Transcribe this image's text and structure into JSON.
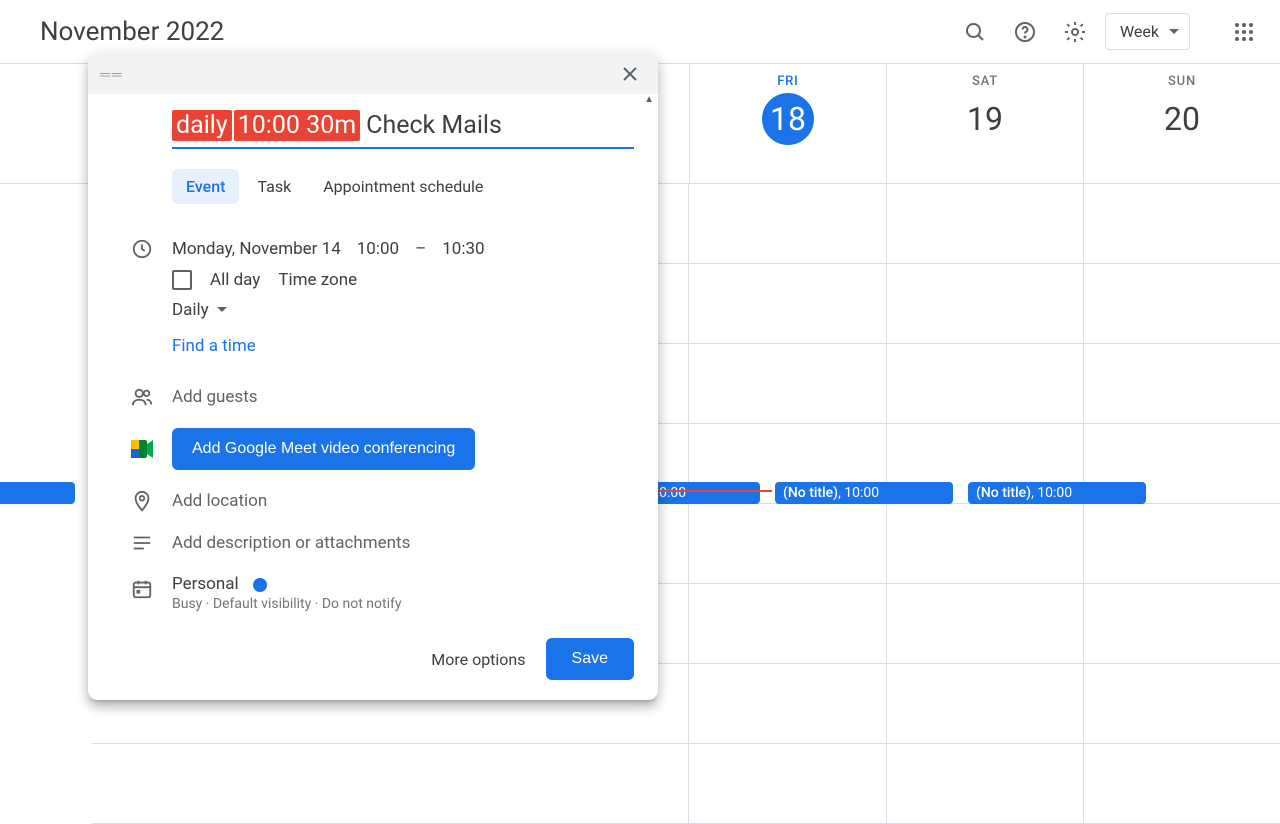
{
  "header": {
    "month_title": "November 2022",
    "view_label": "Week"
  },
  "days": [
    {
      "label": "FRI",
      "num": "18",
      "today": true
    },
    {
      "label": "SAT",
      "num": "19",
      "today": false
    },
    {
      "label": "SUN",
      "num": "20",
      "today": false
    }
  ],
  "events": {
    "fri": {
      "title": "(No title)",
      "time": "10:00"
    },
    "sat": {
      "title": "(No title)",
      "time": "10:00"
    },
    "sun": {
      "title": "(No title)",
      "time": "10:00"
    },
    "partial_left": "0"
  },
  "modal": {
    "title_chips": {
      "chip1": "daily",
      "chip2": "10:00 30m"
    },
    "title_text": "Check Mails",
    "tabs": {
      "event": "Event",
      "task": "Task",
      "appointment": "Appointment schedule"
    },
    "date_text": "Monday, November 14",
    "start_time": "10:00",
    "dash": "–",
    "end_time": "10:30",
    "all_day": "All day",
    "time_zone": "Time zone",
    "recurrence": "Daily",
    "find_time": "Find a time",
    "add_guests": "Add guests",
    "meet_btn": "Add Google Meet video conferencing",
    "add_location": "Add location",
    "add_desc": "Add description or attachments",
    "calendar_name": "Personal",
    "calendar_sub": "Busy · Default visibility · Do not notify",
    "more_options": "More options",
    "save": "Save"
  }
}
